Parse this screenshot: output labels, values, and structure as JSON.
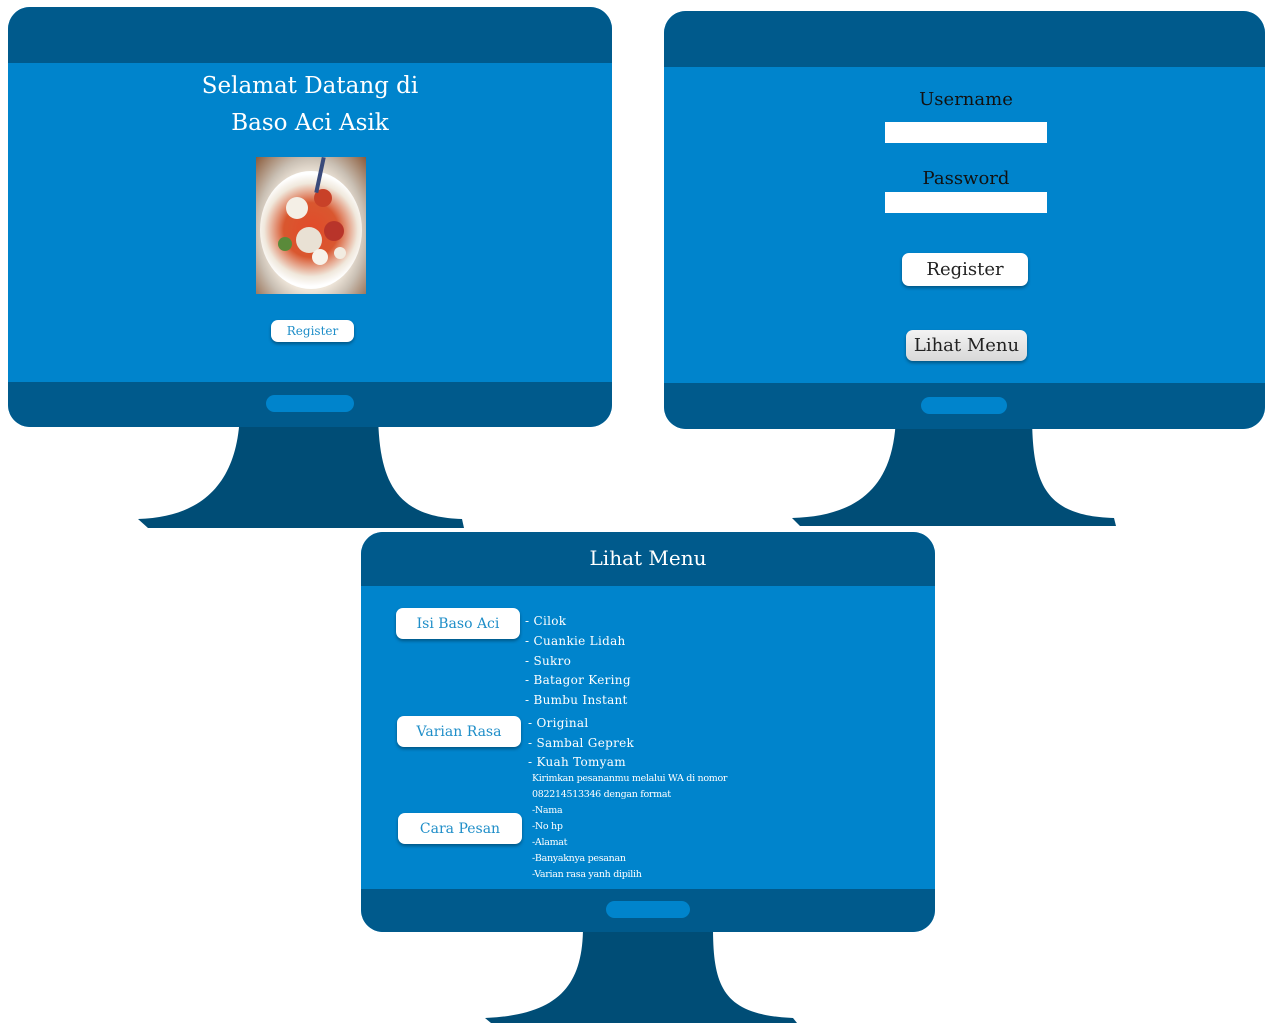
{
  "welcome_screen": {
    "title_line1": "Selamat Datang di",
    "title_line2": "Baso Aci Asik",
    "register_label": "Register"
  },
  "login_screen": {
    "username_label": "Username",
    "username_value": "",
    "password_label": "Password",
    "password_value": "",
    "register_label": "Register",
    "view_menu_label": "Lihat Menu"
  },
  "menu_screen": {
    "title": "Lihat Menu",
    "categories": [
      {
        "label": "Isi Baso Aci",
        "items": [
          "- Cilok",
          "- Cuankie Lidah",
          "- Sukro",
          "- Batagor Kering",
          "- Bumbu Instant"
        ]
      },
      {
        "label": "Varian Rasa",
        "items": [
          "- Original",
          "- Sambal Geprek",
          "- Kuah Tomyam"
        ]
      },
      {
        "label": "Cara Pesan",
        "items": [
          "Kirimkan pesananmu melalui WA di nomor",
          "082214513346 dengan format",
          "-Nama",
          "-No hp",
          "-Alamat",
          "-Banyaknya pesanan",
          "-Varian rasa yanh dipilih"
        ]
      }
    ]
  },
  "colors": {
    "screen": "#0084cc",
    "bezel": "#005a8c",
    "stand": "#004d76",
    "button_text": "#1f8ec8"
  }
}
